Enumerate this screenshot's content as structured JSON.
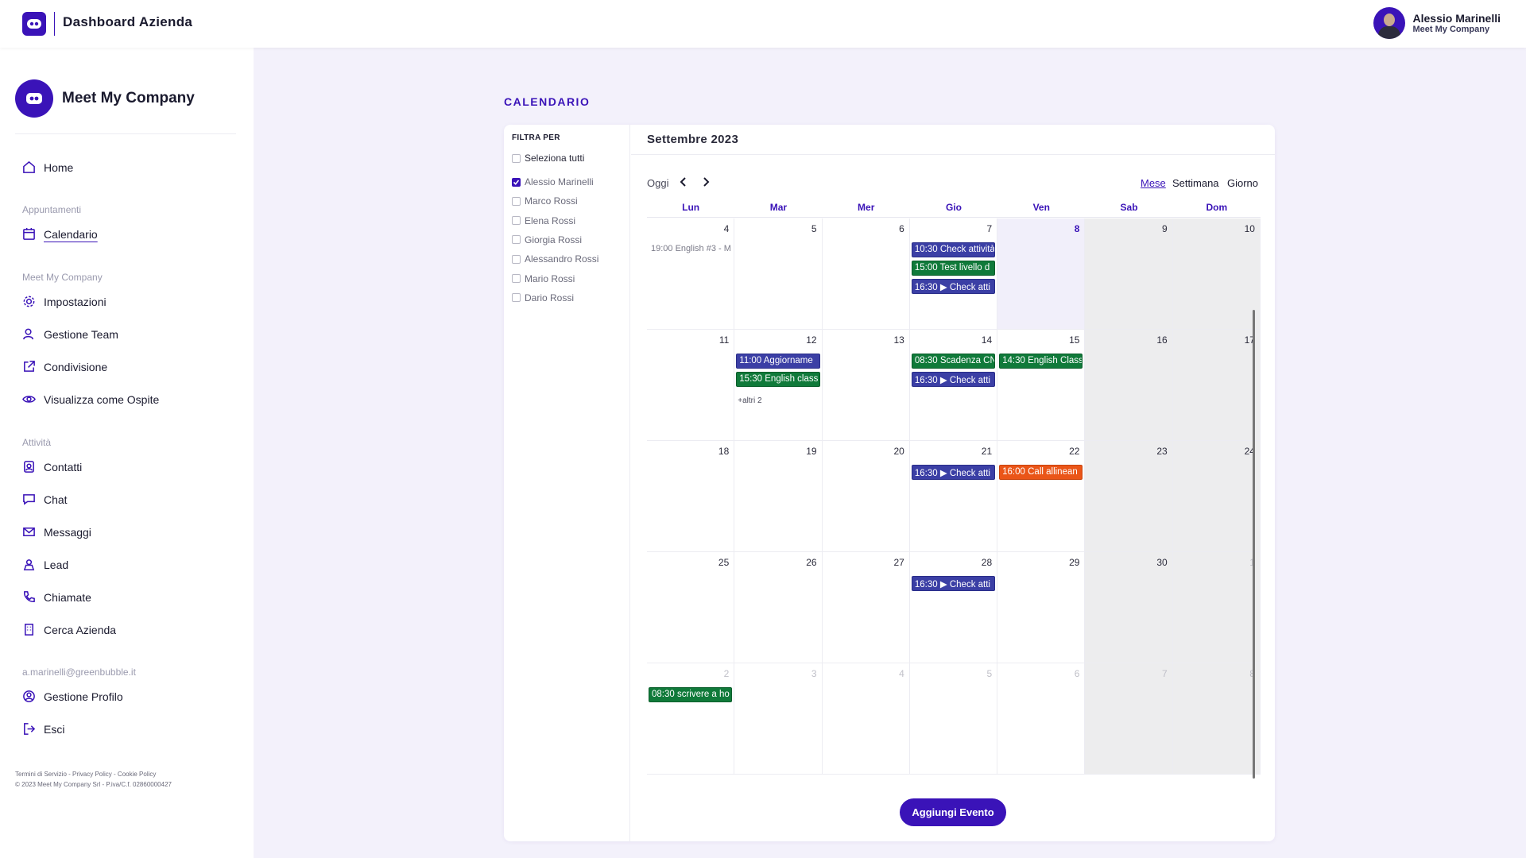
{
  "topbar": {
    "title": "Dashboard Azienda",
    "user_name": "Alessio Marinelli",
    "user_company": "Meet My Company"
  },
  "sidebar": {
    "brand": "Meet My Company",
    "home": "Home",
    "sections": {
      "appuntamenti": "Appuntamenti",
      "meet": "Meet My Company",
      "attivita": "Attività",
      "account": "a.marinelli@greenbubble.it"
    },
    "items": {
      "calendario": "Calendario",
      "impostazioni": "Impostazioni",
      "gestione_team": "Gestione Team",
      "condivisione": "Condivisione",
      "visualizza_ospite": "Visualizza come Ospite",
      "contatti": "Contatti",
      "chat": "Chat",
      "messaggi": "Messaggi",
      "lead": "Lead",
      "chiamate": "Chiamate",
      "cerca_azienda": "Cerca Azienda",
      "gestione_profilo": "Gestione Profilo",
      "esci": "Esci"
    },
    "footer_line1": "Termini di Servizio - Privacy Policy - Cookie Policy",
    "footer_line2": "© 2023 Meet My Company Srl - P.iva/C.f. 02860000427"
  },
  "calendar": {
    "page_title": "CALENDARIO",
    "filter_title": "FILTRA PER",
    "select_all": "Seleziona tutti",
    "people": [
      {
        "name": "Alessio Marinelli",
        "checked": true
      },
      {
        "name": "Marco Rossi",
        "checked": false
      },
      {
        "name": "Elena Rossi",
        "checked": false
      },
      {
        "name": "Giorgia Rossi",
        "checked": false
      },
      {
        "name": "Alessandro Rossi",
        "checked": false
      },
      {
        "name": "Mario Rossi",
        "checked": false
      },
      {
        "name": "Dario Rossi",
        "checked": false
      }
    ],
    "month": "Settembre 2023",
    "today_label": "Oggi",
    "views": {
      "month": "Mese",
      "week": "Settimana",
      "day": "Giorno"
    },
    "weekdays": [
      "Lun",
      "Mar",
      "Mer",
      "Gio",
      "Ven",
      "Sab",
      "Dom"
    ],
    "weeks": [
      [
        {
          "day": "4",
          "events": [
            {
              "text": "19:00 English #3 - M",
              "color": "plain"
            }
          ]
        },
        {
          "day": "5",
          "events": []
        },
        {
          "day": "6",
          "events": []
        },
        {
          "day": "7",
          "events": [
            {
              "text": "10:30 Check attività",
              "color": "blue"
            },
            {
              "text": "15:00 Test livello d",
              "color": "green"
            },
            {
              "text": "16:30 ▶ Check atti",
              "color": "blue"
            }
          ]
        },
        {
          "day": "8",
          "today": true,
          "events": []
        },
        {
          "day": "9",
          "weekend": true,
          "events": []
        },
        {
          "day": "10",
          "weekend": true,
          "events": []
        }
      ],
      [
        {
          "day": "11",
          "events": []
        },
        {
          "day": "12",
          "events": [
            {
              "text": "11:00 Aggiorname",
              "color": "blue"
            },
            {
              "text": "15:30 English class",
              "color": "green"
            }
          ],
          "more": "+altri 2"
        },
        {
          "day": "13",
          "events": []
        },
        {
          "day": "14",
          "events": [
            {
              "text": "08:30 Scadenza CN",
              "color": "green"
            },
            {
              "text": "16:30 ▶ Check atti",
              "color": "blue"
            }
          ]
        },
        {
          "day": "15",
          "events": [
            {
              "text": "14:30 English Class",
              "color": "green"
            }
          ]
        },
        {
          "day": "16",
          "weekend": true,
          "events": []
        },
        {
          "day": "17",
          "weekend": true,
          "events": []
        }
      ],
      [
        {
          "day": "18",
          "events": []
        },
        {
          "day": "19",
          "events": []
        },
        {
          "day": "20",
          "events": []
        },
        {
          "day": "21",
          "events": [
            {
              "text": "16:30 ▶ Check atti",
              "color": "blue"
            }
          ]
        },
        {
          "day": "22",
          "events": [
            {
              "text": "16:00 Call allinean",
              "color": "orange"
            }
          ]
        },
        {
          "day": "23",
          "weekend": true,
          "events": []
        },
        {
          "day": "24",
          "weekend": true,
          "events": []
        }
      ],
      [
        {
          "day": "25",
          "events": []
        },
        {
          "day": "26",
          "events": []
        },
        {
          "day": "27",
          "events": []
        },
        {
          "day": "28",
          "events": [
            {
              "text": "16:30 ▶ Check atti",
              "color": "blue"
            }
          ]
        },
        {
          "day": "29",
          "events": []
        },
        {
          "day": "30",
          "weekend": true,
          "events": []
        },
        {
          "day": "1",
          "weekend": true,
          "other": true,
          "events": []
        }
      ],
      [
        {
          "day": "2",
          "other": true,
          "events": [
            {
              "text": "08:30 scrivere a ho",
              "color": "green"
            }
          ]
        },
        {
          "day": "3",
          "other": true,
          "events": []
        },
        {
          "day": "4",
          "other": true,
          "events": []
        },
        {
          "day": "5",
          "other": true,
          "events": []
        },
        {
          "day": "6",
          "other": true,
          "events": []
        },
        {
          "day": "7",
          "weekend": true,
          "other": true,
          "events": []
        },
        {
          "day": "8",
          "weekend": true,
          "other": true,
          "events": []
        }
      ]
    ],
    "add_button": "Aggiungi Evento"
  }
}
